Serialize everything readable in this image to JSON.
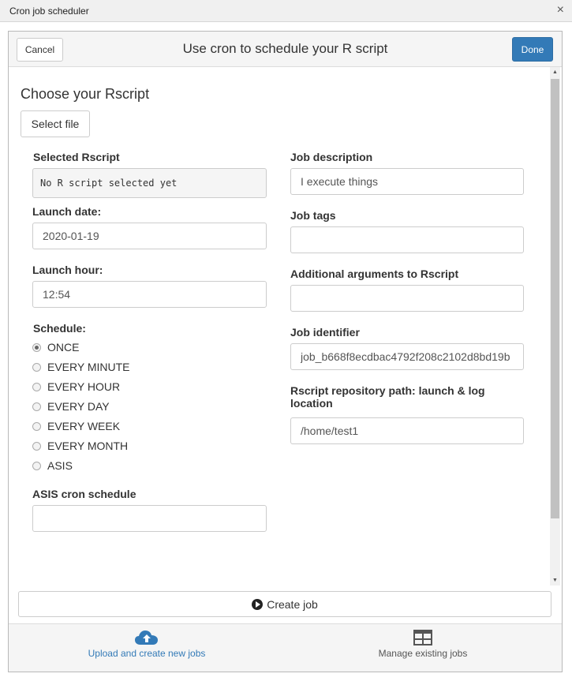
{
  "window": {
    "title": "Cron job scheduler",
    "close_glyph": "×"
  },
  "header": {
    "title": "Use cron to schedule your R script",
    "cancel_label": "Cancel",
    "done_label": "Done"
  },
  "section": {
    "title": "Choose your Rscript",
    "select_file_label": "Select file"
  },
  "left": {
    "selected_label": "Selected Rscript",
    "selected_value": "No R script selected yet",
    "launch_date_label": "Launch date:",
    "launch_date_value": "2020-01-19",
    "launch_hour_label": "Launch hour:",
    "launch_hour_value": "12:54",
    "schedule_label": "Schedule:",
    "schedule_options": [
      "ONCE",
      "EVERY MINUTE",
      "EVERY HOUR",
      "EVERY DAY",
      "EVERY WEEK",
      "EVERY MONTH",
      "ASIS"
    ],
    "schedule_selected": "ONCE",
    "asis_label": "ASIS cron schedule",
    "asis_value": ""
  },
  "right": {
    "job_description_label": "Job description",
    "job_description_value": "I execute things",
    "job_tags_label": "Job tags",
    "job_tags_value": "",
    "additional_args_label": "Additional arguments to Rscript",
    "additional_args_value": "",
    "job_identifier_label": "Job identifier",
    "job_identifier_value": "job_b668f8ecdbac4792f208c2102d8bd19b",
    "repo_path_label_line1": "Rscript repository path: launch & log",
    "repo_path_label_line2": "location",
    "repo_path_value": "/home/test1"
  },
  "footer": {
    "create_job_label": "Create job",
    "create_icon": "play-circle-icon"
  },
  "tabs": [
    {
      "label": "Upload and create new jobs",
      "icon": "cloud-upload-icon",
      "active": true,
      "color": "#337ab7"
    },
    {
      "label": "Manage existing jobs",
      "icon": "table-icon",
      "active": false,
      "color": "#555555"
    }
  ],
  "colors": {
    "primary": "#337ab7",
    "header_bg": "#f5f5f5",
    "border": "#cccccc"
  }
}
